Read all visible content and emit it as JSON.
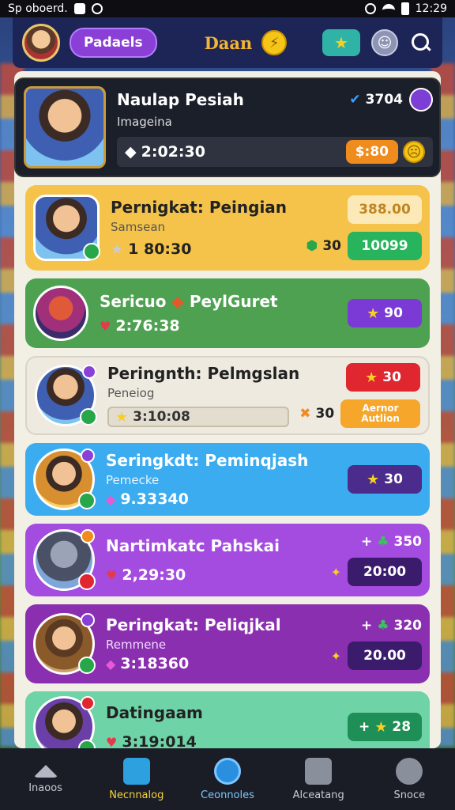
{
  "status_bar": {
    "carrier": "Sp oboerd.",
    "time": "12:29"
  },
  "header": {
    "profile_pill": "Padaels",
    "title": "Daan",
    "coin_symbol": "⚡"
  },
  "featured": {
    "name": "Naulap Pesiah",
    "sub": "Imageina",
    "likes": "3704",
    "time": "2:02:30",
    "reward": "$:80"
  },
  "cards": [
    {
      "name": "Pernigkat: Peingian",
      "sub": "Samsean",
      "time": "1 80:30",
      "tag_top": "388.00",
      "stat": "30",
      "tag_bottom": "10099"
    },
    {
      "name": "Sericuo",
      "name2": "PeylGuret",
      "time": "2:76:38",
      "tag": "90"
    },
    {
      "name": "Peringnth: Pelmgslan",
      "sub": "Peneiog",
      "progress": "3:10:08",
      "tag_top": "30",
      "stat": "30",
      "tag_bottom": "Aernor Autlion"
    },
    {
      "name": "Seringkdt: Peminqjash",
      "sub": "Pemecke",
      "time": "9.33340",
      "tag": "30"
    },
    {
      "name": "Nartimkatc Pahskai",
      "time": "2,29:30",
      "stat": "350",
      "tag": "20:00"
    },
    {
      "name": "Peringkat: Peliqjkal",
      "sub": "Remmene",
      "time": "3:18360",
      "stat": "320",
      "tag": "20.00"
    },
    {
      "name": "Datingaam",
      "time": "3:19:014",
      "tag": "28"
    }
  ],
  "bottom_nav": [
    {
      "label": "Inaoos"
    },
    {
      "label": "Necnnalog"
    },
    {
      "label": "Ceonnoles"
    },
    {
      "label": "Alceatang"
    },
    {
      "label": "Snoce"
    }
  ]
}
